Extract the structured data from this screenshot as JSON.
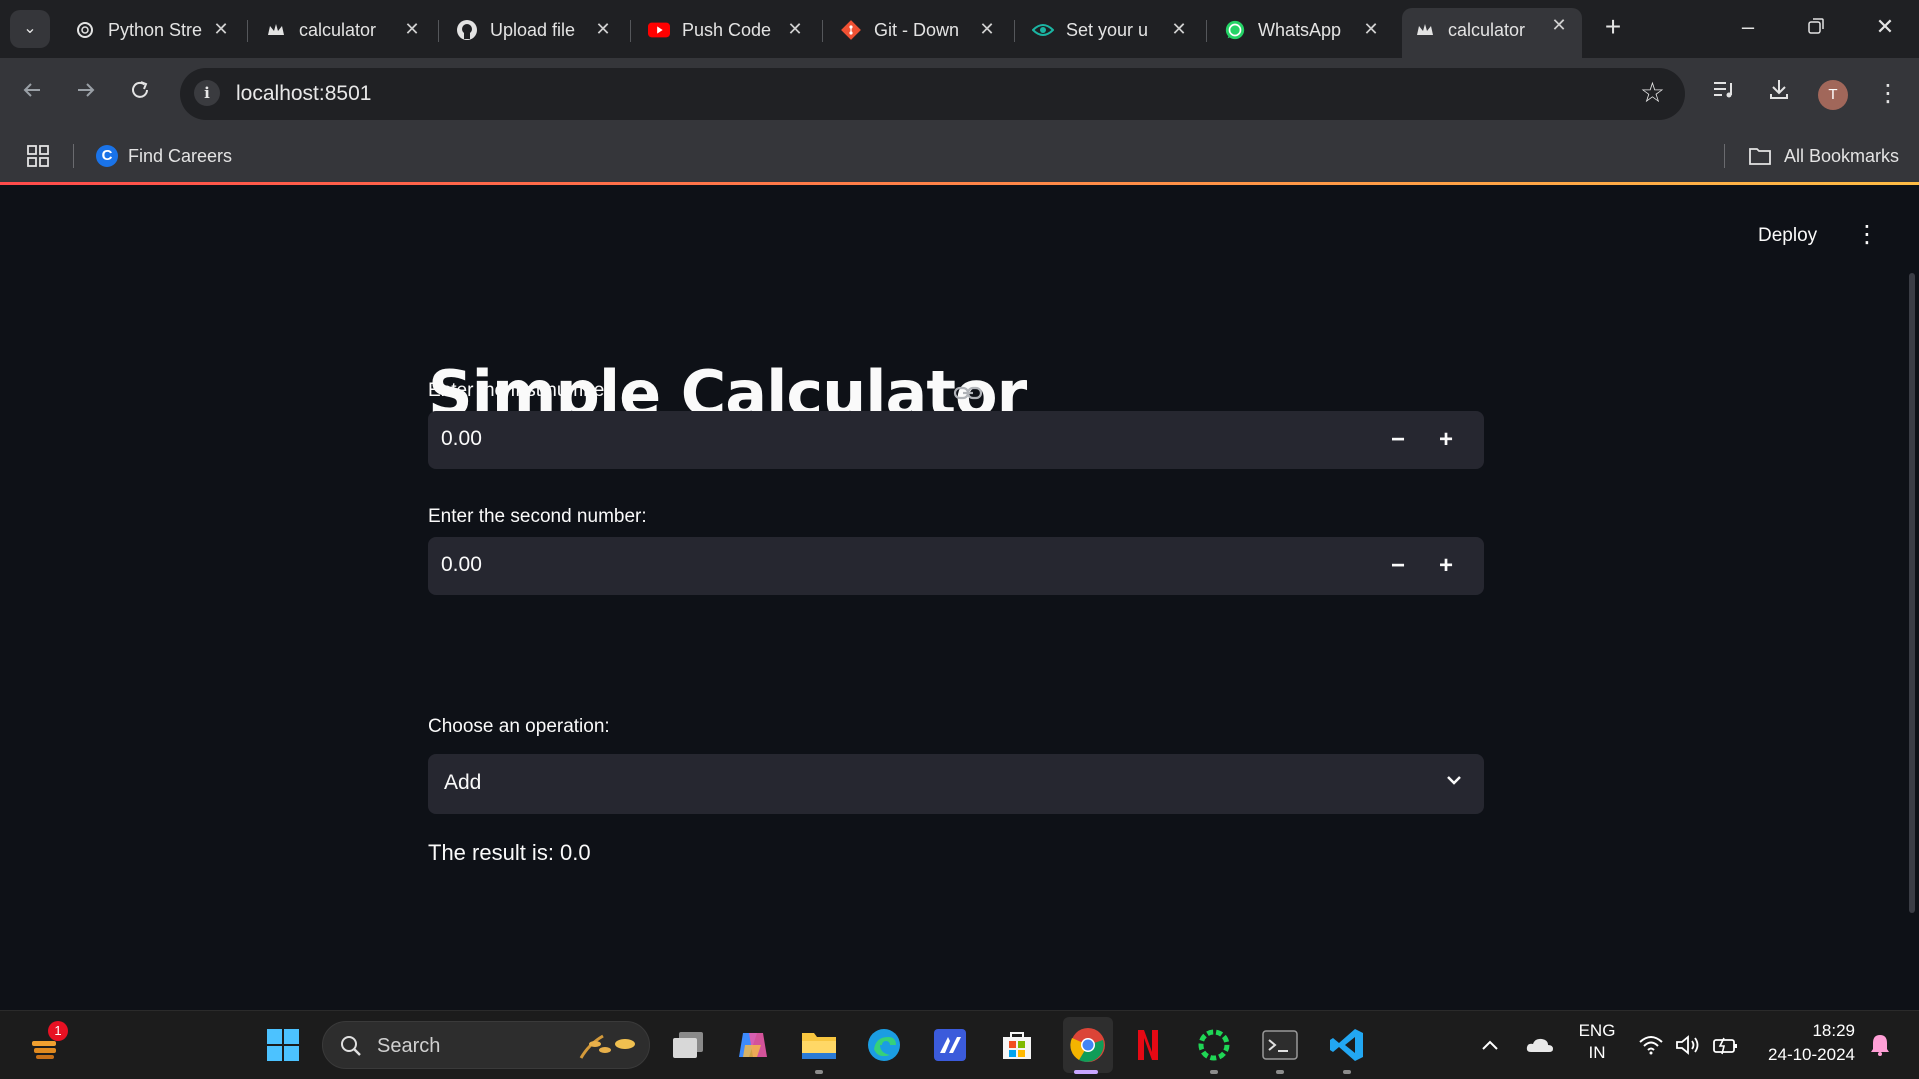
{
  "browser": {
    "tabs": [
      {
        "title": "Python Stre",
        "icon": "openai-icon"
      },
      {
        "title": "calculator",
        "icon": "streamlit-crown-icon"
      },
      {
        "title": "Upload file",
        "icon": "github-icon"
      },
      {
        "title": "Push Code",
        "icon": "youtube-icon"
      },
      {
        "title": "Git - Down",
        "icon": "git-icon"
      },
      {
        "title": "Set your u",
        "icon": "eye-icon"
      },
      {
        "title": "WhatsApp",
        "icon": "whatsapp-icon"
      },
      {
        "title": "calculator",
        "icon": "streamlit-crown-icon",
        "active": true
      }
    ],
    "url": "localhost:8501",
    "avatar_initial": "T",
    "bookmarks": [
      {
        "label": "Find Careers",
        "icon": "c-logo-icon"
      }
    ],
    "all_bookmarks_label": "All Bookmarks"
  },
  "app": {
    "deploy_label": "Deploy",
    "title": "Simple Calculator",
    "first_label": "Enter the first number:",
    "first_value": "0.00",
    "second_label": "Enter the second number:",
    "second_value": "0.00",
    "operation_label": "Choose an operation:",
    "operation_value": "Add",
    "result_text": "The result is: 0.0"
  },
  "taskbar": {
    "search_label": "Search",
    "notification_count": "1",
    "language": "ENG",
    "region": "IN",
    "time": "18:29",
    "date": "24-10-2024"
  },
  "colors": {
    "page_bg": "#0e1117",
    "input_bg": "#262730",
    "accent_gradient_start": "#ff4b4b",
    "accent_gradient_end": "#ffbd45"
  }
}
